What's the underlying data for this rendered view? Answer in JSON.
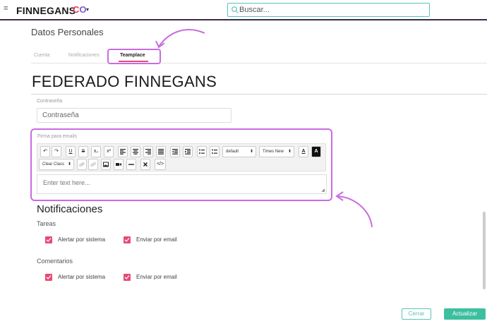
{
  "app": {
    "logo": "FINNEGANS",
    "logo_co_1": "C",
    "logo_co_2": "O",
    "menu_icon": "hamburger-icon",
    "caret": "▾"
  },
  "search": {
    "placeholder": "Buscar..."
  },
  "header": {
    "title": "Datos Personales"
  },
  "tabs": [
    {
      "label": "Cuenta"
    },
    {
      "label": "Notificaciones"
    },
    {
      "label": "Teamplace"
    }
  ],
  "profile": {
    "name": "FEDERADO FINNEGANS"
  },
  "password": {
    "label": "Contraseña",
    "placeholder": "Contraseña"
  },
  "signature": {
    "label": "Firma para emails",
    "editor_placeholder": "Enter text here...",
    "toolbar": {
      "undo": "↶",
      "redo": "↷",
      "underline": "U",
      "strike": "S",
      "subscript": "x₂",
      "superscript": "x²",
      "font_size": "default",
      "font_family": "Times New",
      "font_color": "A",
      "bg_color": "A",
      "clear_class": "Clear Class",
      "code": "</>"
    }
  },
  "notifications": {
    "title": "Notificaciones",
    "groups": [
      {
        "label": "Tareas",
        "options": [
          "Alertar por sistema",
          "Enviar por email"
        ]
      },
      {
        "label": "Comentarios",
        "options": [
          "Alertar por sistema",
          "Enviar por email"
        ]
      }
    ]
  },
  "actions": {
    "cancel": "Cerrar",
    "save": "Actualizar"
  },
  "colors": {
    "accent": "#e64a73",
    "teal": "#3dbf9f",
    "highlight": "#c86ce0"
  }
}
